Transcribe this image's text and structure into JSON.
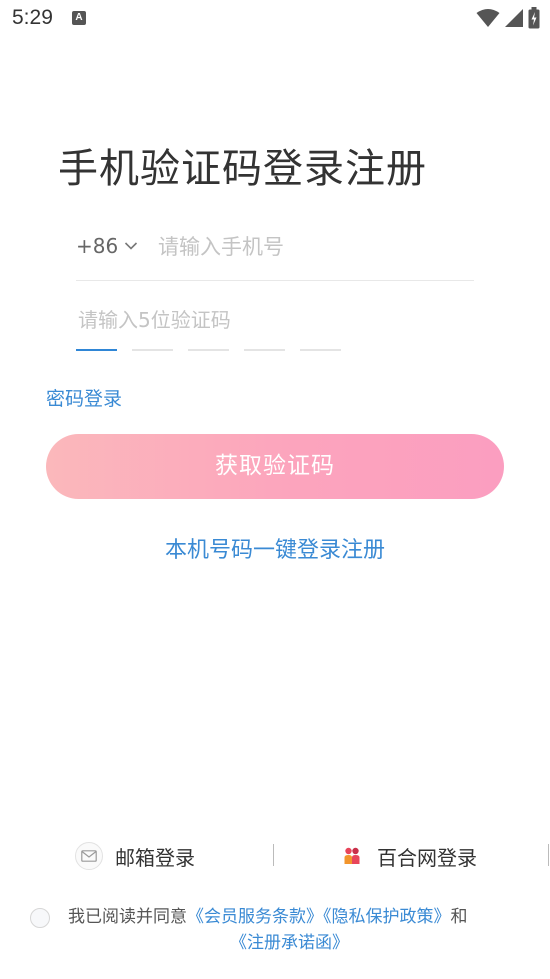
{
  "status_bar": {
    "time": "5:29",
    "notification_glyph": "A",
    "icons": [
      "wifi-icon",
      "signal-icon",
      "battery-icon"
    ]
  },
  "title": "手机验证码登录注册",
  "phone": {
    "country_code": "+86",
    "placeholder": "请输入手机号",
    "value": ""
  },
  "code": {
    "placeholder": "请输入5位验证码",
    "slots": 5,
    "active_slot": 1
  },
  "password_login": "密码登录",
  "get_code_button": "获取验证码",
  "one_click_login": "本机号码一键登录注册",
  "alt_logins": {
    "email": "邮箱登录",
    "baihe": "百合网登录"
  },
  "agreement": {
    "prefix": "我已阅读并同意",
    "terms": "《会员服务条款》",
    "privacy": "《隐私保护政策》",
    "conj": "和",
    "commitment": "《注册承诺函》",
    "checked": false
  },
  "colors": {
    "accent": "#3a8ad4",
    "button_start": "#fbb8bb",
    "button_end": "#fb9ec0"
  }
}
